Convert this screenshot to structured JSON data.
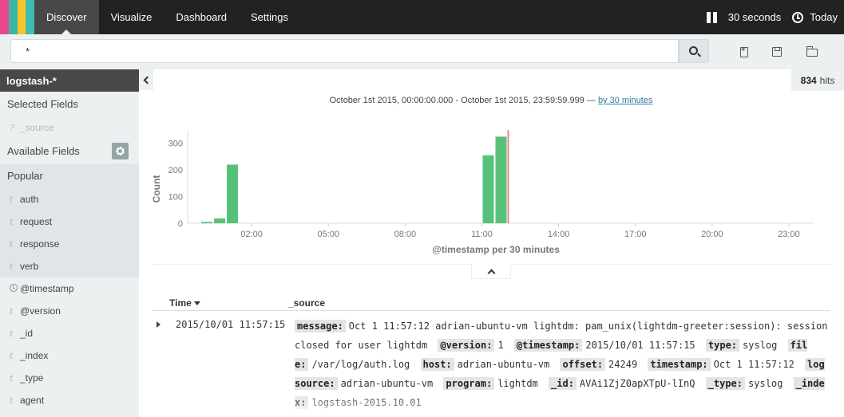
{
  "nav": {
    "tabs": [
      {
        "label": "Discover",
        "active": true
      },
      {
        "label": "Visualize"
      },
      {
        "label": "Dashboard"
      },
      {
        "label": "Settings"
      }
    ],
    "refresh_interval": "30 seconds",
    "time_label": "Today",
    "logo_colors": [
      "#e8488b",
      "#3cb3a9",
      "#fcc328",
      "#3ebeb0"
    ]
  },
  "search": {
    "query": "*"
  },
  "sidebar": {
    "index_pattern": "logstash-*",
    "selected_fields_label": "Selected Fields",
    "selected_fields": [
      {
        "type": "?",
        "name": "_source"
      }
    ],
    "available_fields_label": "Available Fields",
    "popular_label": "Popular",
    "popular_fields": [
      {
        "type": "t",
        "name": "auth"
      },
      {
        "type": "t",
        "name": "request"
      },
      {
        "type": "t",
        "name": "response"
      },
      {
        "type": "t",
        "name": "verb"
      }
    ],
    "other_fields": [
      {
        "type": "clock",
        "name": "@timestamp"
      },
      {
        "type": "t",
        "name": "@version"
      },
      {
        "type": "t",
        "name": "_id"
      },
      {
        "type": "t",
        "name": "_index"
      },
      {
        "type": "t",
        "name": "_type"
      },
      {
        "type": "t",
        "name": "agent"
      }
    ]
  },
  "hits": {
    "count": "834",
    "label": "hits"
  },
  "timerange": {
    "text": "October 1st 2015, 00:00:00.000 - October 1st 2015, 23:59:59.999 —",
    "interval_link": "by 30 minutes"
  },
  "chart_data": {
    "type": "bar",
    "ylabel": "Count",
    "xlabel": "@timestamp per 30 minutes",
    "ylim": [
      0,
      350
    ],
    "yticks": [
      0,
      100,
      200,
      300
    ],
    "xlim_hours": [
      -0.5,
      24
    ],
    "xticks": [
      {
        "hour": 2,
        "label": "02:00"
      },
      {
        "hour": 5,
        "label": "05:00"
      },
      {
        "hour": 8,
        "label": "08:00"
      },
      {
        "hour": 11,
        "label": "11:00"
      },
      {
        "hour": 14,
        "label": "14:00"
      },
      {
        "hour": 17,
        "label": "17:00"
      },
      {
        "hour": 20,
        "label": "20:00"
      },
      {
        "hour": 23,
        "label": "23:00"
      }
    ],
    "bars": [
      {
        "hour": 0.0,
        "value": 5
      },
      {
        "hour": 0.5,
        "value": 18
      },
      {
        "hour": 1.0,
        "value": 220
      },
      {
        "hour": 11.0,
        "value": 255
      },
      {
        "hour": 11.5,
        "value": 325
      }
    ],
    "bar_color": "#57c17b",
    "now_marker_hour": 12.0,
    "now_marker_color": "#e8878a"
  },
  "table": {
    "time_header": "Time",
    "source_header": "_source",
    "rows": [
      {
        "time": "2015/10/01 11:57:15",
        "fields": [
          {
            "k": "message:",
            "v": "Oct 1 11:57:12 adrian-ubuntu-vm lightdm: pam_unix(lightdm-greeter:session): session closed for user lightdm"
          },
          {
            "k": "@version:",
            "v": "1"
          },
          {
            "k": "@timestamp:",
            "v": "2015/10/01 11:57:15"
          },
          {
            "k": "type:",
            "v": "syslog"
          },
          {
            "k": "file:",
            "v": "/var/log/auth.log"
          },
          {
            "k": "host:",
            "v": "adrian-ubuntu-vm"
          },
          {
            "k": "offset:",
            "v": "24249"
          },
          {
            "k": "timestamp:",
            "v": "Oct 1 11:57:12"
          },
          {
            "k": "logsource:",
            "v": "adrian-ubuntu-vm"
          },
          {
            "k": "program:",
            "v": "lightdm"
          },
          {
            "k": "_id:",
            "v": "AVAi1ZjZ0apXTpU-lInQ"
          },
          {
            "k": "_type:",
            "v": "syslog"
          },
          {
            "k": "_index:",
            "v": "logstash-2015.10.01"
          }
        ]
      }
    ]
  }
}
